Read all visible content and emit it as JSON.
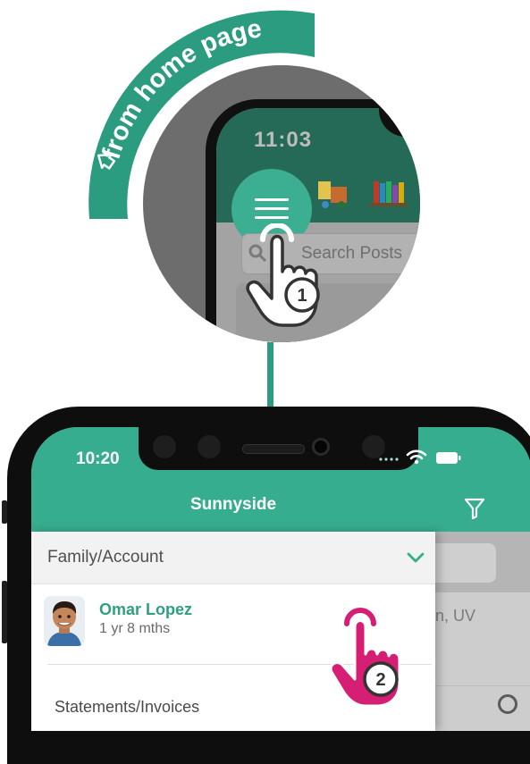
{
  "callout": {
    "label": "from home page",
    "step1": "1",
    "step2": "2"
  },
  "zoom": {
    "time": "11:03",
    "search_placeholder": "Search Posts"
  },
  "status_bar": {
    "time": "10:20"
  },
  "header": {
    "title": "Sunnyside"
  },
  "drawer": {
    "section_title": "Family/Account",
    "child": {
      "name": "Omar Lopez",
      "age": "1 yr 8 mths"
    },
    "menu_item": "Statements/Invoices"
  },
  "background_content": {
    "card_snippet": "n, UV"
  },
  "colors": {
    "brand_green": "#36ad8e",
    "callout_green": "#2b9c80",
    "pink": "#d61e74"
  }
}
